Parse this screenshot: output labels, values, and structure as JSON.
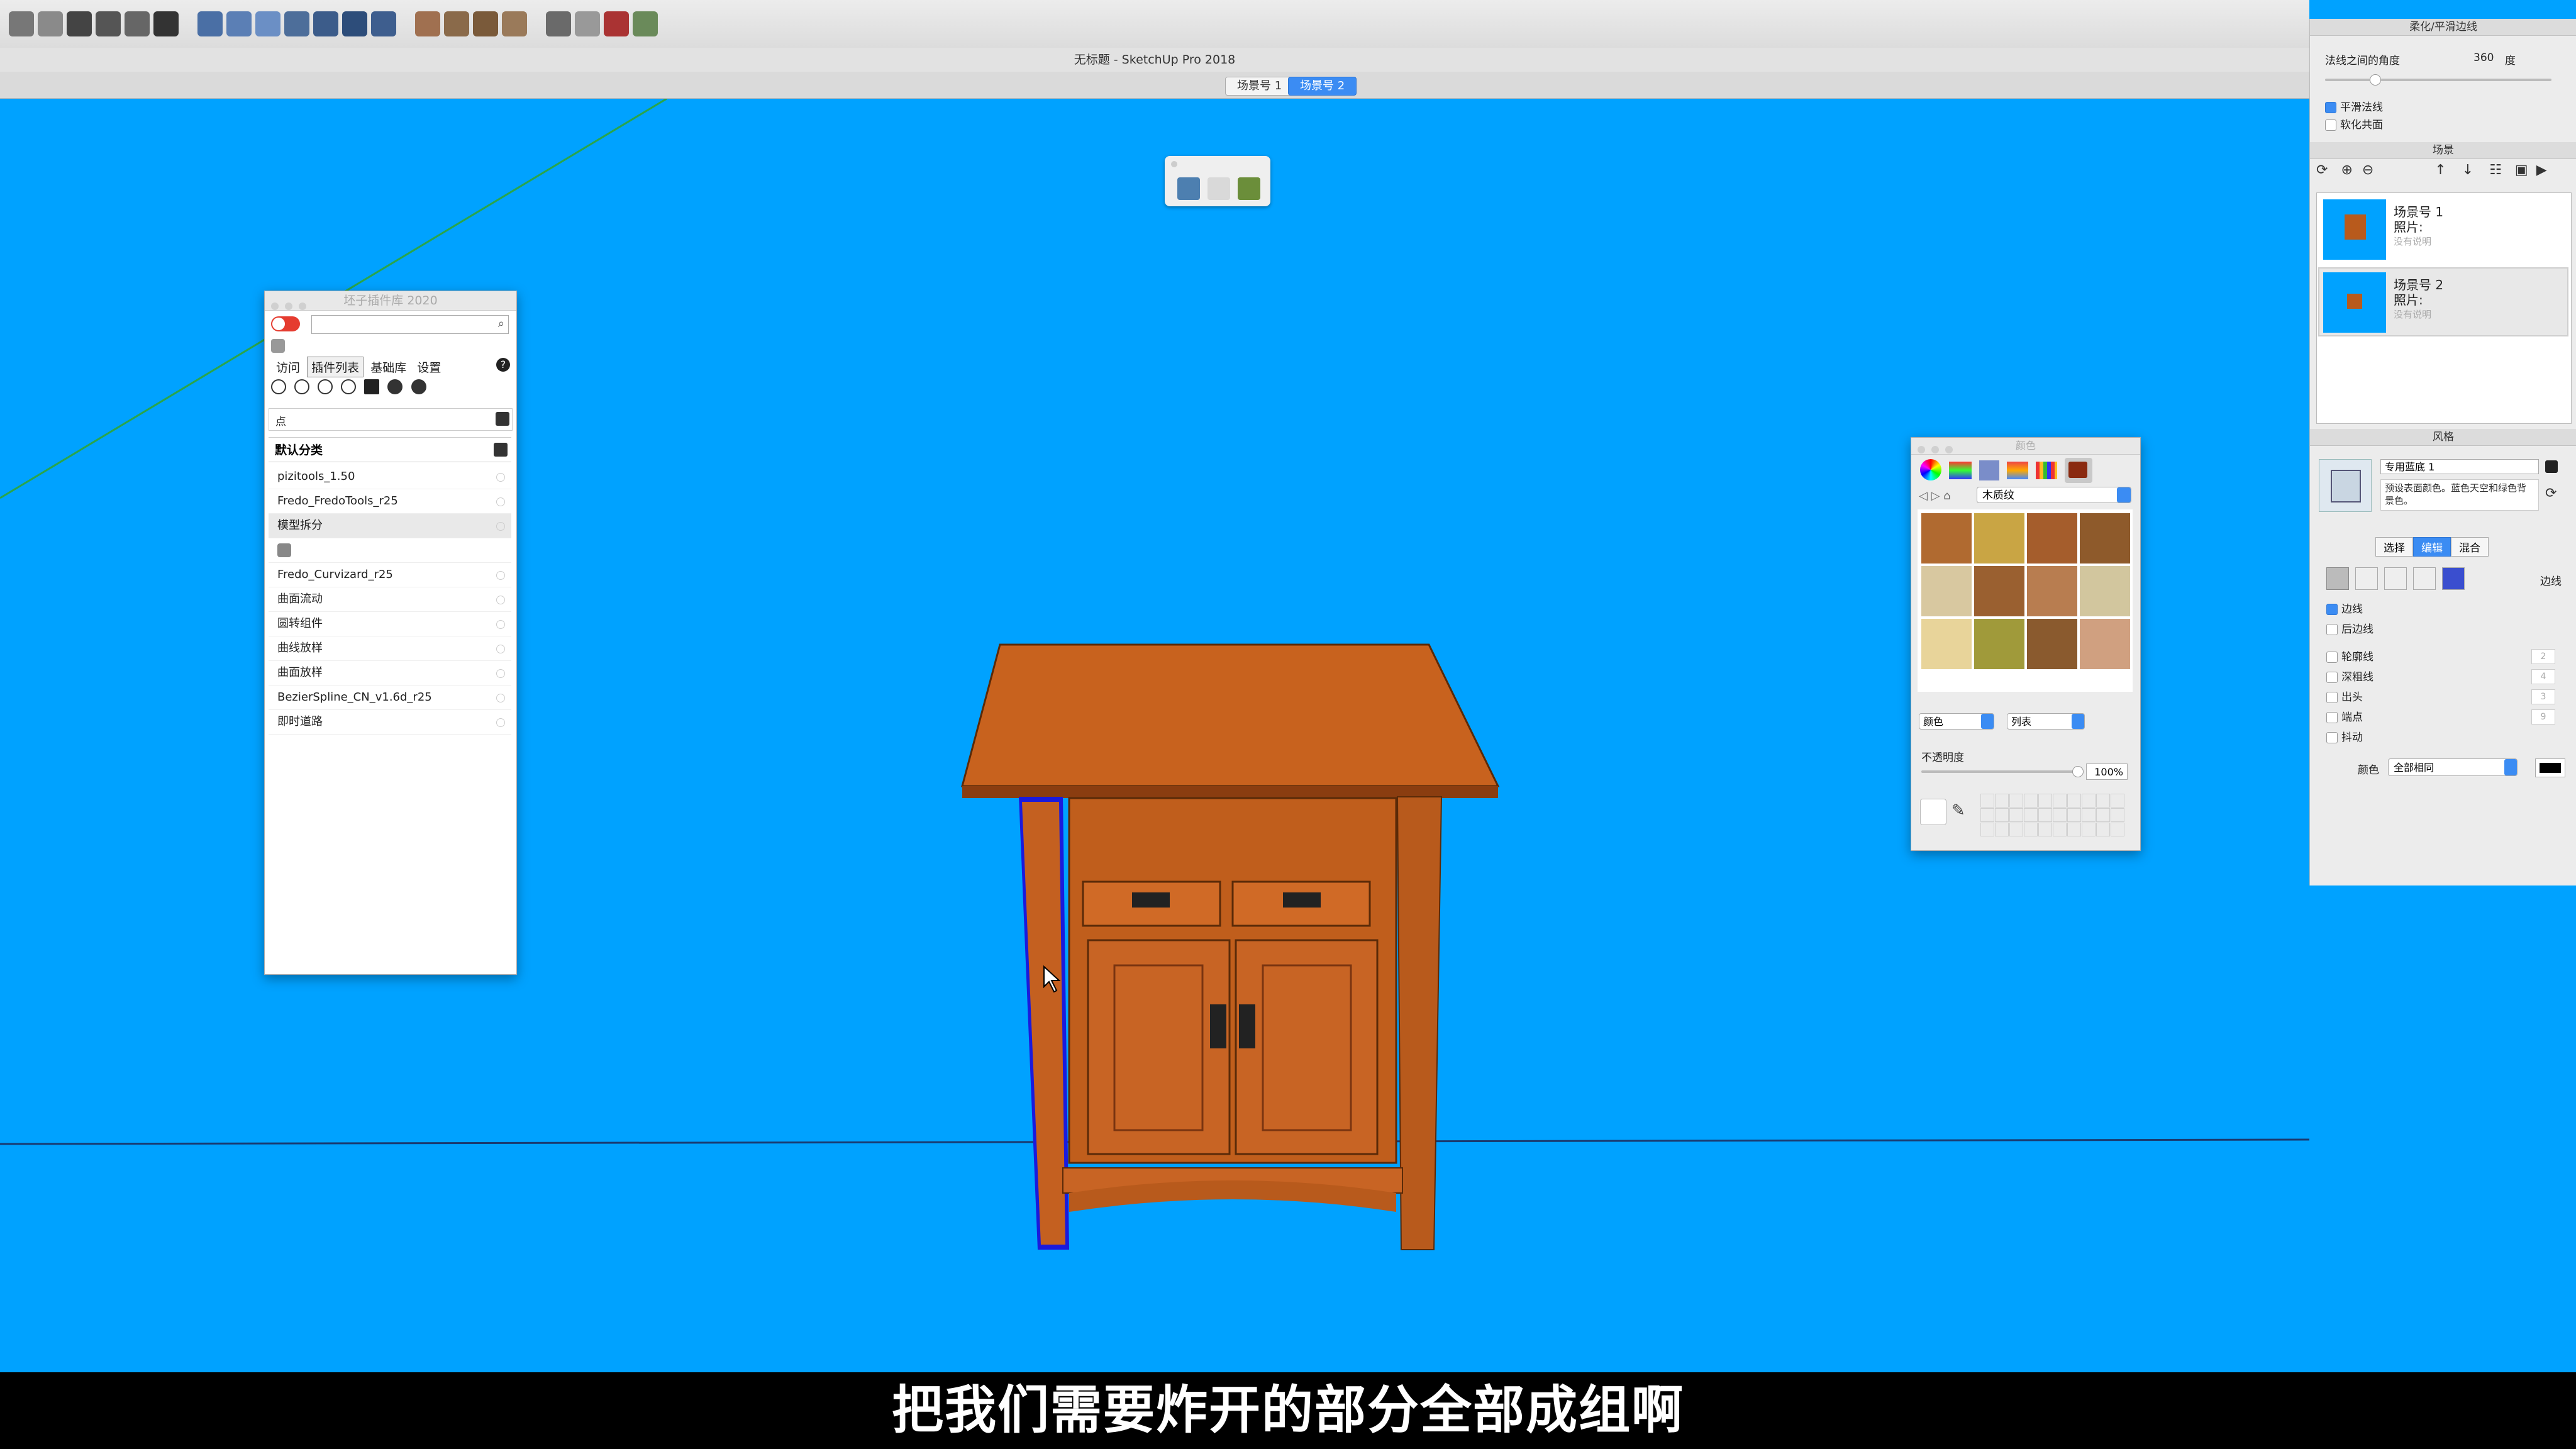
{
  "app": {
    "window_title": "无标题 - SketchUp Pro 2018",
    "scene_tabs": [
      {
        "label": "场景号 1",
        "active": false
      },
      {
        "label": "场景号 2",
        "active": true
      }
    ]
  },
  "toolbar": {
    "icons": [
      "select-icon",
      "eraser-icon",
      "home-icon",
      "camera-icon",
      "scenes-icon",
      "house-outline-icon",
      "box-front-icon",
      "box-top-icon",
      "box-right-icon",
      "box-back-icon",
      "box-left-icon",
      "box-iso-icon",
      "box-bottom-icon",
      "sandbox-icon",
      "terrain-icon",
      "stamp-icon",
      "drape-icon",
      "add-detail-icon",
      "flip-edge-icon",
      "warehouse-icon",
      "extension-icon"
    ]
  },
  "plugin_panel": {
    "title": "坯子插件库 2020",
    "search_value": "",
    "tabs": [
      "访问",
      "插件列表",
      "基础库",
      "设置"
    ],
    "active_tab": "插件列表",
    "help": "?",
    "filter_value": "点",
    "category": "默认分类",
    "items": [
      {
        "label": "pizitools_1.50",
        "gray": false
      },
      {
        "label": "Fredo_FredoTools_r25",
        "gray": false
      },
      {
        "label": "模型拆分",
        "gray": true
      },
      {
        "label": "",
        "gray": false,
        "icon_only": true
      },
      {
        "label": "Fredo_Curvizard_r25",
        "gray": false
      },
      {
        "label": "曲面流动",
        "gray": false
      },
      {
        "label": "圆转组件",
        "gray": false
      },
      {
        "label": "曲线放样",
        "gray": false
      },
      {
        "label": "曲面放样",
        "gray": false
      },
      {
        "label": "BezierSpline_CN_v1.6d_r25",
        "gray": false
      },
      {
        "label": "即时道路",
        "gray": false
      }
    ]
  },
  "colors_panel": {
    "title": "颜色",
    "library": "木质纹",
    "dropdown_1": "颜色",
    "dropdown_2": "列表",
    "opacity_label": "不透明度",
    "opacity_value": "100%",
    "swatches": [
      "#b06a30",
      "#c9a544",
      "#a55d2c",
      "#8e5a2b",
      "#d8c8a0",
      "#9a6030",
      "#b87d50",
      "#d2c69e",
      "#e8d49a",
      "#a09a3a",
      "#8a5a2e",
      "#d0a080"
    ]
  },
  "soften_panel": {
    "title": "柔化/平滑边线",
    "angle_label": "法线之间的角度",
    "angle_value": "360",
    "angle_unit": "度",
    "angle_fraction": 0.22,
    "smooth_label": "平滑法线",
    "smooth_checked": true,
    "coplanar_label": "软化共面",
    "coplanar_checked": false
  },
  "scenes_panel": {
    "title": "场景",
    "scenes": [
      {
        "name": "场景号 1",
        "photo_label": "照片:",
        "desc": "没有说明"
      },
      {
        "name": "场景号 2",
        "photo_label": "照片:",
        "desc": "没有说明"
      }
    ]
  },
  "styles_panel": {
    "title": "风格",
    "style_name": "专用蓝底 1",
    "style_desc": "预设表面颜色。蓝色天空和绿色背景色。",
    "tabs": [
      "选择",
      "编辑",
      "混合"
    ],
    "active_tab": "编辑",
    "edges_label": "边线",
    "options": [
      {
        "label": "边线",
        "checked": true,
        "value": ""
      },
      {
        "label": "后边线",
        "checked": false,
        "value": ""
      },
      {
        "label": "轮廓线",
        "checked": false,
        "value": "2"
      },
      {
        "label": "深粗线",
        "checked": false,
        "value": "4"
      },
      {
        "label": "出头",
        "checked": false,
        "value": "3"
      },
      {
        "label": "端点",
        "checked": false,
        "value": "9"
      },
      {
        "label": "抖动",
        "checked": false,
        "value": ""
      }
    ],
    "color_label": "颜色",
    "color_value": "全部相同"
  },
  "subtitle": "把我们需要炸开的部分全部成组啊",
  "colors": {
    "sky": "#00a2ff",
    "wood": "#c8621e",
    "wood_dark": "#8a3d10",
    "accent": "#3b8cf3",
    "subtitle_bg": "#000000"
  }
}
